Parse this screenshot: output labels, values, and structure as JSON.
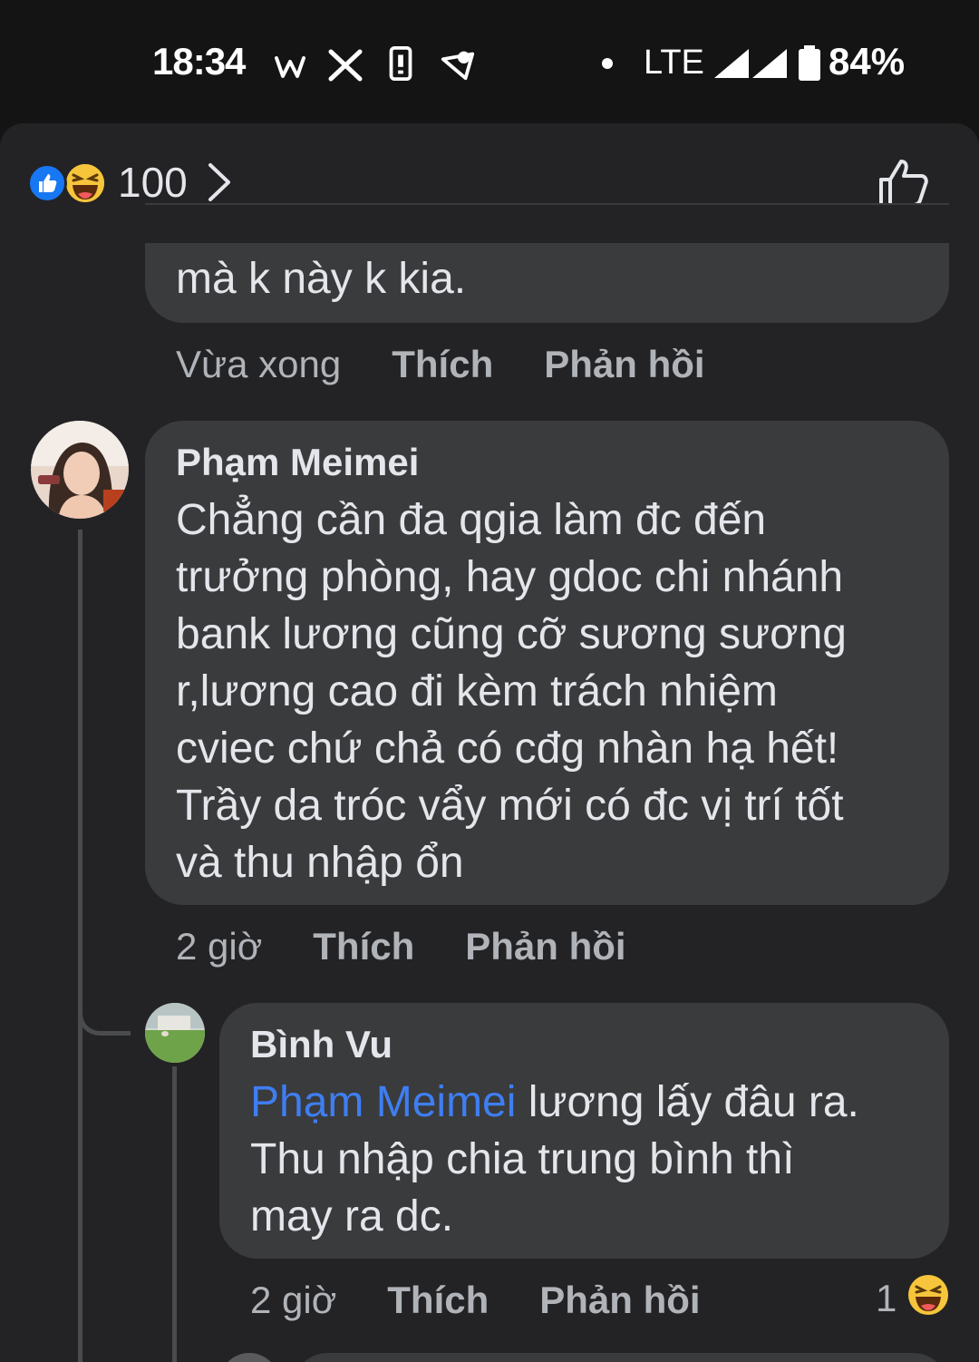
{
  "status_bar": {
    "time": "18:34",
    "network": "LTE",
    "battery": "84%",
    "icons": [
      "w-icon",
      "x-icon",
      "phone-icon",
      "android-icon"
    ]
  },
  "header": {
    "reaction_count": "100",
    "reaction_icons": [
      "like-reaction-icon",
      "haha-reaction-icon"
    ]
  },
  "comments": [
    {
      "text_tail": "mà k này k kia.",
      "time": "Vừa xong",
      "like_label": "Thích",
      "reply_label": "Phản hồi"
    },
    {
      "author": "Phạm Meimei",
      "text": "Chẳng cần đa qgia làm đc đến trưởng phòng, hay gdoc chi nhánh bank lương cũng cỡ sương sương r,lương cao đi kèm trách nhiệm cviec chứ chả có cđg nhàn hạ hết! Trầy da tróc vẩy mới có đc vị trí tốt và thu nhập ổn",
      "lines": [
        "Chẳng cần đa qgia làm đc đến",
        "trưởng phòng, hay gdoc chi nhánh",
        "bank lương cũng cỡ sương sương",
        "r,lương cao đi kèm trách nhiệm",
        "cviec chứ chả có cđg nhàn hạ hết!",
        "Trầy da tróc vẩy mới có đc vị trí tốt",
        "và thu nhập ổn"
      ],
      "time": "2 giờ",
      "like_label": "Thích",
      "reply_label": "Phản hồi"
    },
    {
      "author": "Bình Vu",
      "mention": "Phạm Meimei",
      "line1_rest": " lương lấy đâu ra.",
      "lines": [
        "Thu nhập chia trung bình thì",
        "may ra dc."
      ],
      "time": "2 giờ",
      "like_label": "Thích",
      "reply_label": "Phản hồi",
      "reaction_count": "1"
    }
  ],
  "colors": {
    "background": "#141414",
    "sheet": "#232325",
    "bubble": "#3a3b3c",
    "mention": "#3f7ef2",
    "secondary_text": "#b0b3b8"
  }
}
